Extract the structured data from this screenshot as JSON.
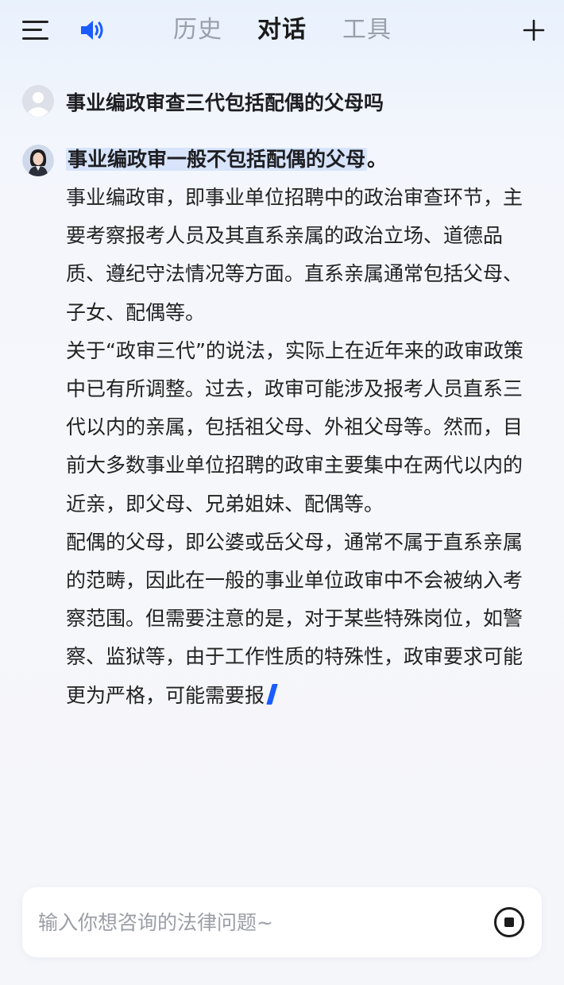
{
  "header": {
    "tabs": [
      {
        "label": "历史",
        "active": false
      },
      {
        "label": "对话",
        "active": true
      },
      {
        "label": "工具",
        "active": false
      }
    ],
    "menu_icon": "hamburger-menu-icon",
    "speaker_icon": "speaker-volume-icon",
    "new_icon": "plus-icon"
  },
  "conversation": {
    "user_question": "事业编政审查三代包括配偶的父母吗",
    "answer": {
      "highlighted_lead": "事业编政审一般不包括配偶的父母",
      "lead_tail": "。",
      "paragraphs": [
        "事业编政审，即事业单位招聘中的政治审查环节，主要考察报考人员及其直系亲属的政治立场、道德品质、遵纪守法情况等方面。直系亲属通常包括父母、子女、配偶等。",
        "关于“政审三代”的说法，实际上在近年来的政审政策中已有所调整。过去，政审可能涉及报考人员直系三代以内的亲属，包括祖父母、外祖父母等。然而，目前大多数事业单位招聘的政审主要集中在两代以内的近亲，即父母、兄弟姐妹、配偶等。",
        "配偶的父母，即公婆或岳父母，通常不属于直系亲属的范畴，因此在一般的事业单位政审中不会被纳入考察范围。但需要注意的是，对于某些特殊岗位，如警察、监狱等，由于工作性质的特殊性，政审要求可能更为严格，可能需要报"
      ]
    }
  },
  "input": {
    "placeholder": "输入你想咨询的法律问题~",
    "value": "",
    "stop_icon": "stop-generating-icon"
  },
  "colors": {
    "accent": "#1a5cff",
    "highlight": "#d7e4fb",
    "tab_inactive": "#9aa0aa"
  }
}
